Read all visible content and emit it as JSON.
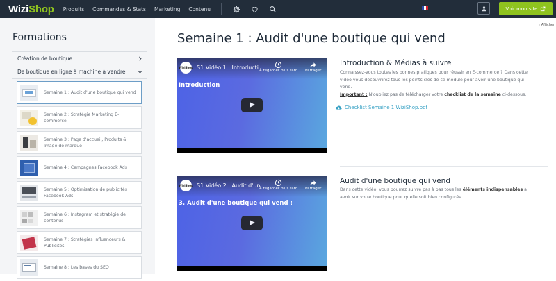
{
  "brand": {
    "logo_main": "Wizi",
    "logo_accent": "Shop"
  },
  "nav": {
    "items": [
      "Produits",
      "Commandes & Stats",
      "Marketing",
      "Contenu"
    ]
  },
  "header": {
    "language_flag": "fr",
    "view_site_label": "Voir mon site"
  },
  "sidebar": {
    "title": "Formations",
    "links": [
      {
        "label": "Création de boutique",
        "icon": "chevron-right-icon"
      },
      {
        "label": "De boutique en ligne à machine à vendre",
        "icon": "chevron-down-icon"
      }
    ],
    "lessons": [
      {
        "label": "Semaine 1 : Audit d'une boutique qui vend",
        "active": true
      },
      {
        "label": "Semaine 2 : Stratégie Marketing E-commerce"
      },
      {
        "label": "Semaine 3 : Page d'accueil, Produits & Image de marque"
      },
      {
        "label": "Semaine 4 : Campagnes Facebook Ads"
      },
      {
        "label": "Semaine 5 : Optimisation de publicités Facebook Ads"
      },
      {
        "label": "Semaine 6 : Instagram et stratégie de contenus"
      },
      {
        "label": "Semaine 7 : Stratégies Influenceurs & Publicités"
      },
      {
        "label": "Semaine 8 : Les bases du SEO"
      }
    ]
  },
  "main": {
    "afficher": "Afficher",
    "title": "Semaine 1 : Audit d'une boutique qui vend",
    "videos": [
      {
        "channel": "WiziShop",
        "title": "S1 Vidéo 1 : Introducti...",
        "heading": "Introduction",
        "watch_later": "À regarder plus tard",
        "share": "Partager"
      },
      {
        "channel": "WiziShop",
        "title": "S1 Vidéo 2 : Audit d'un...",
        "heading": "3. Audit d'une boutique qui vend :",
        "watch_later": "À regarder plus tard",
        "share": "Partager"
      }
    ],
    "sections": [
      {
        "title": "Introduction & Médias à suivre",
        "p1": "Connaissez-vous toutes les bonnes pratiques pour réussir en E-commerce ? Dans cette vidéo vous découvrirez tous les points clés de ce module pour avoir une boutique qui vend.",
        "important_label": "Important :",
        "p2_a": " N'oubliez pas de télécharger votre ",
        "p2_b": "checklist de la semaine",
        "p2_c": " ci-dessous.",
        "pdf_label": "Checklist Semaine 1 WiziShop.pdf"
      },
      {
        "title": "Audit d'une boutique qui vend",
        "p1_a": "Dans cette vidéo, vous pourrez suivre pas à pas tous les ",
        "p1_b": "éléments indispensables",
        "p1_c": " à avoir sur votre boutique pour quelle soit bien configurée."
      }
    ]
  },
  "colors": {
    "topbar": "#222d3a",
    "accent_green": "#8fc31f",
    "link_blue": "#37a1c4"
  }
}
